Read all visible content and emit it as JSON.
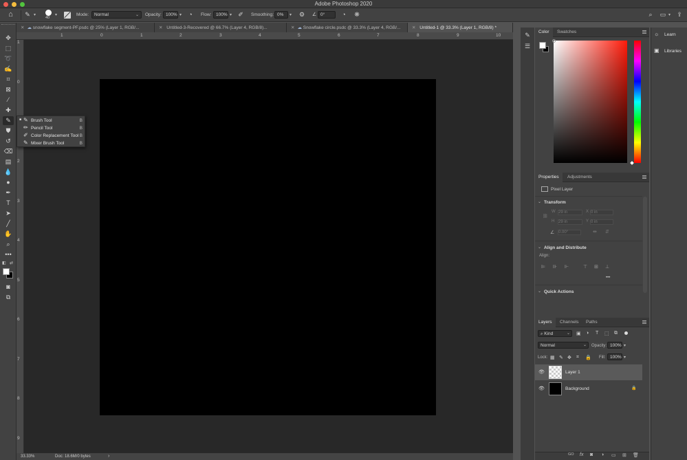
{
  "app": {
    "title": "Adobe Photoshop 2020"
  },
  "options": {
    "brush_size": "40",
    "mode_label": "Mode:",
    "mode_value": "Normal",
    "opacity_label": "Opacity:",
    "opacity_value": "100%",
    "flow_label": "Flow:",
    "flow_value": "100%",
    "smoothing_label": "Smoothing:",
    "smoothing_value": "0%",
    "angle_value": "0°"
  },
  "tabs": [
    {
      "label": "snowflake segment-PF.psdc @ 25% (Layer 1, RGB/..."
    },
    {
      "label": "Untitled-3-Recovered @ 66.7% (Layer 4, RGB/8)..."
    },
    {
      "label": "Snowflake circle.psdc @ 33.3% (Layer 4, RGB/..."
    },
    {
      "label": "Untitled-1 @ 33.3% (Layer 1, RGB/8) *"
    }
  ],
  "ruler": {
    "top": [
      "1",
      "0",
      "1",
      "2",
      "3",
      "4",
      "5",
      "6",
      "7",
      "8",
      "9",
      "10"
    ],
    "left": [
      "1",
      "0",
      "1",
      "2",
      "3",
      "4",
      "5",
      "6",
      "7",
      "8",
      "9"
    ]
  },
  "status": {
    "zoom": "33.33%",
    "doc": "Doc: 18.6M/0 bytes"
  },
  "flyout": {
    "items": [
      {
        "label": "Brush Tool",
        "key": "B",
        "current": "■"
      },
      {
        "label": "Pencil Tool",
        "key": "B",
        "current": ""
      },
      {
        "label": "Color Replacement Tool",
        "key": "B",
        "current": ""
      },
      {
        "label": "Mixer Brush Tool",
        "key": "B",
        "current": ""
      }
    ]
  },
  "color_panel": {
    "tabs": [
      "Color",
      "Swatches"
    ]
  },
  "properties_panel": {
    "tabs": [
      "Properties",
      "Adjustments"
    ],
    "layer_type": "Pixel Layer",
    "transform_title": "Transform",
    "w_label": "W",
    "h_label": "H",
    "x_label": "X",
    "y_label": "Y",
    "w_value": "29 in",
    "h_value": "29 in",
    "x_value": "0 in",
    "y_value": "0 in",
    "angle_value": "0.00°",
    "align_title": "Align and Distribute",
    "align_label": "Align:",
    "more": "•••",
    "quick_title": "Quick Actions"
  },
  "layers_panel": {
    "tabs": [
      "Layers",
      "Channels",
      "Paths"
    ],
    "kind": "Kind",
    "blend_mode": "Normal",
    "opacity_label": "Opacity:",
    "opacity_value": "100%",
    "lock_label": "Lock:",
    "fill_label": "Fill:",
    "fill_value": "100%",
    "layers": [
      {
        "name": "Layer 1"
      },
      {
        "name": "Background"
      }
    ],
    "bottom_icons": [
      "GO",
      "fx"
    ]
  },
  "learn": {
    "learn_label": "Learn",
    "libraries_label": "Libraries"
  },
  "colors": {
    "foreground": "#ffffff",
    "background": "#000000"
  }
}
